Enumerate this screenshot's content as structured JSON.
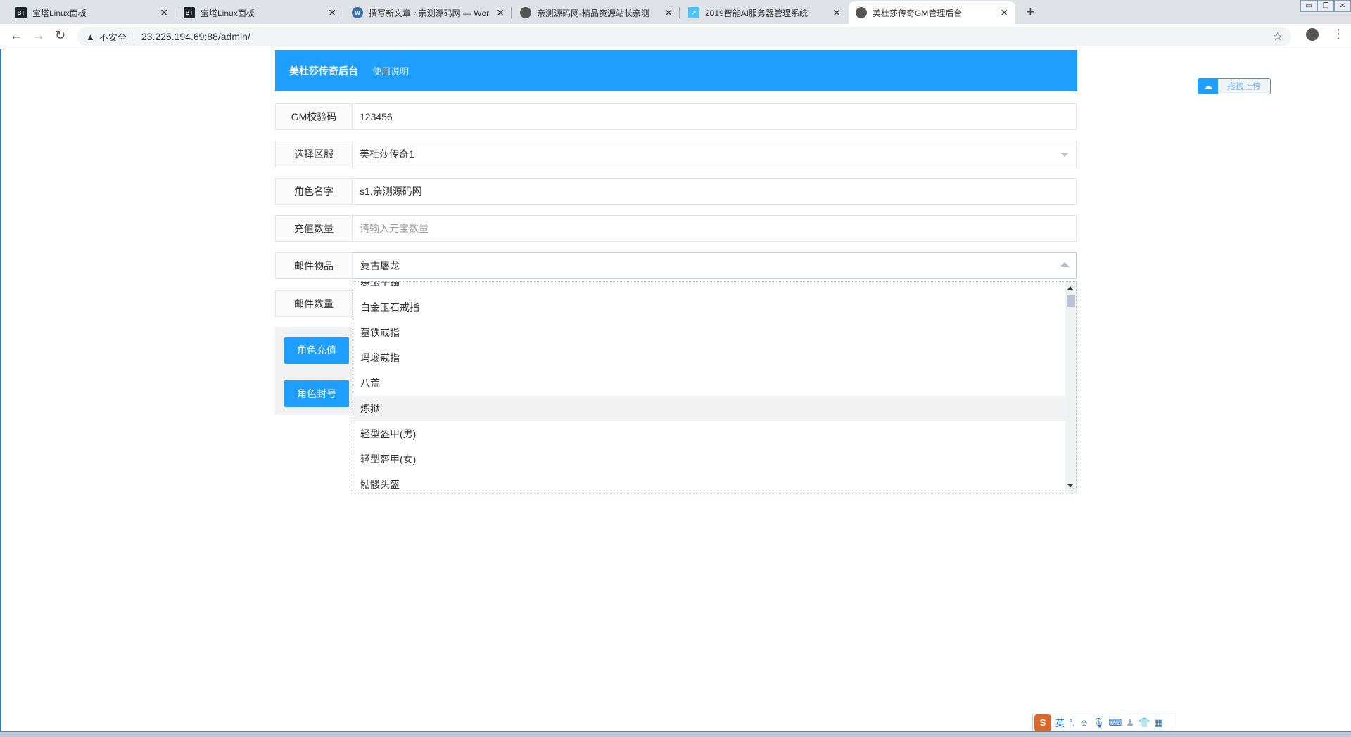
{
  "browser": {
    "tabs": [
      {
        "title": "宝塔Linux面板",
        "icon": "bt-icon",
        "color": "#20242b"
      },
      {
        "title": "宝塔Linux面板",
        "icon": "bt-icon",
        "color": "#20242b"
      },
      {
        "title": "撰写新文章 ‹ 亲测源码网 — Wor",
        "icon": "wordpress-icon",
        "color": "#3a6fa8"
      },
      {
        "title": "亲测源码网-精品资源站长亲测",
        "icon": "globe-icon",
        "color": "#555555"
      },
      {
        "title": "2019智能AI服务器管理系统",
        "icon": "chart-icon",
        "color": "#4fc3f7"
      },
      {
        "title": "美杜莎传奇GM管理后台",
        "icon": "globe-icon",
        "color": "#555555",
        "active": true
      }
    ],
    "bt_label": "BT",
    "security_label": "不安全",
    "url": "23.225.194.69:88/admin/"
  },
  "header": {
    "brand": "美杜莎传奇后台",
    "help_link": "使用说明"
  },
  "form": {
    "gm_code": {
      "label": "GM校验码",
      "value": "123456"
    },
    "server": {
      "label": "选择区服",
      "value": "美杜莎传奇1"
    },
    "role_name": {
      "label": "角色名字",
      "value": "s1.亲测源码网"
    },
    "recharge": {
      "label": "充值数量",
      "placeholder": "请输入元宝数量"
    },
    "mail_item": {
      "label": "邮件物品",
      "value": "复古屠龙"
    },
    "mail_count": {
      "label": "邮件数量"
    }
  },
  "buttons": {
    "recharge": "角色充值",
    "ban": "角色封号"
  },
  "dropdown": {
    "items": [
      "寒玉手镯",
      "白金玉石戒指",
      "墓铁戒指",
      "玛瑙戒指",
      "八荒",
      "炼狱",
      "轻型盔甲(男)",
      "轻型盔甲(女)",
      "骷髅头盔"
    ],
    "highlighted": "炼狱"
  },
  "upload": {
    "label": "拖拽上传"
  },
  "ime": {
    "logo": "S",
    "mode": "英"
  }
}
